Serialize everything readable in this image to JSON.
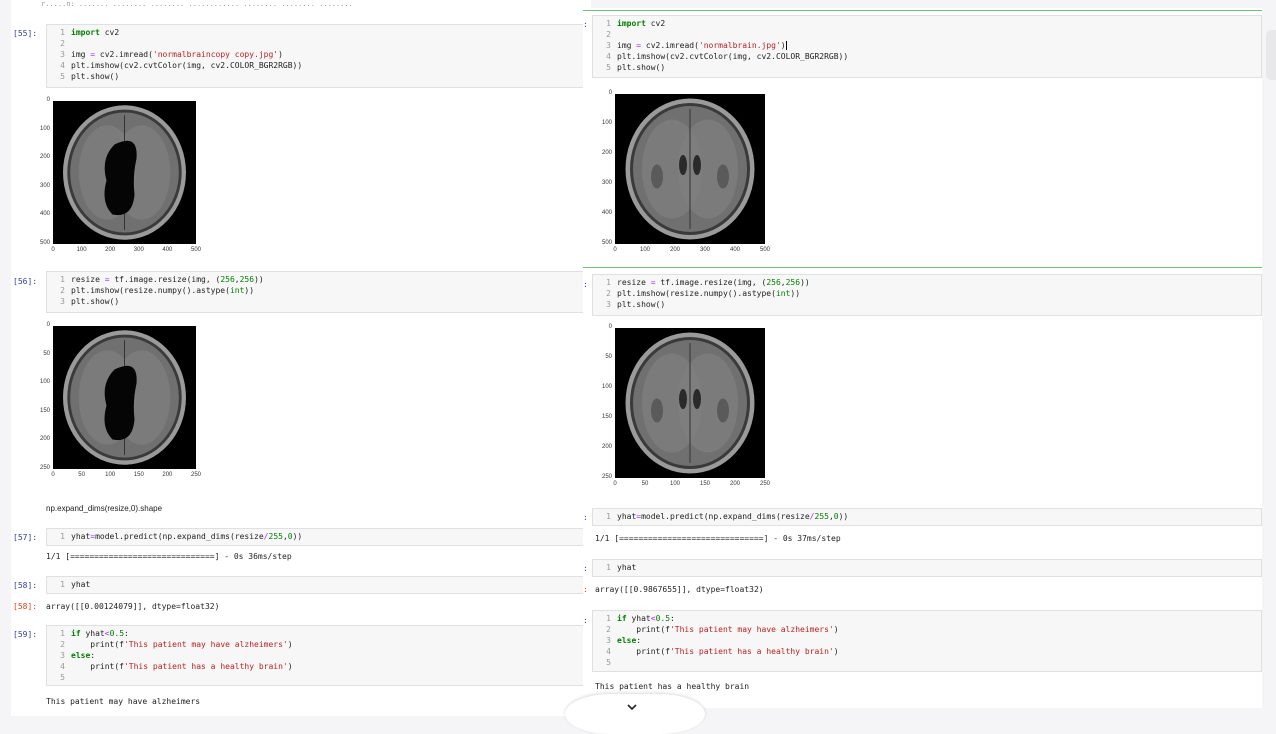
{
  "left": {
    "top_blurred": "r.....n: ....... ........ ........ ............ ........ ........ ........",
    "cells": [
      {
        "prompt": "[55]:",
        "lines": [
          "import cv2",
          "",
          "img = cv2.imread('normalbraincopy copy.jpg')",
          "plt.imshow(cv2.cvtColor(img, cv2.COLOR_BGR2RGB))",
          "plt.show()"
        ]
      },
      {
        "prompt": "[56]:",
        "lines": [
          "resize = tf.image.resize(img, (256,256))",
          "plt.imshow(resize.numpy().astype(int))",
          "plt.show()"
        ]
      },
      {
        "prompt": "[57]:",
        "lines": [
          "yhat=model.predict(np.expand_dims(resize/255,0))"
        ]
      },
      {
        "prompt": "[58]:",
        "lines": [
          "yhat"
        ]
      },
      {
        "prompt": "[59]:",
        "lines": [
          "if yhat<0.5:",
          "    print(f'This patient may have alzheimers')",
          "else:",
          "    print(f'This patient has a healthy brain')",
          ""
        ]
      }
    ],
    "plot1": {
      "yticks": [
        "0",
        "100",
        "200",
        "300",
        "400",
        "500"
      ],
      "xticks": [
        "0",
        "100",
        "200",
        "300",
        "400",
        "500"
      ]
    },
    "plot2": {
      "yticks": [
        "0",
        "50",
        "100",
        "150",
        "200",
        "250"
      ],
      "xticks": [
        "0",
        "50",
        "100",
        "150",
        "200",
        "250"
      ]
    },
    "markdown": "np.expand_dims(resize,0).shape",
    "predict_output": "1/1 [==============================] - 0s 36ms/step",
    "out_prompt_58": "[58]:",
    "yhat_output": "array([[0.00124079]], dtype=float32)",
    "print_output": "This patient may have alzheimers"
  },
  "right": {
    "cells": [
      {
        "prompt": ":",
        "lines": [
          "import cv2",
          "",
          "img = cv2.imread('normalbrain.jpg')",
          "plt.imshow(cv2.cvtColor(img, cv2.COLOR_BGR2RGB))",
          "plt.show()"
        ]
      },
      {
        "prompt": ":",
        "lines": [
          "resize = tf.image.resize(img, (256,256))",
          "plt.imshow(resize.numpy().astype(int))",
          "plt.show()"
        ]
      },
      {
        "prompt": ":",
        "lines": [
          "yhat=model.predict(np.expand_dims(resize/255,0))"
        ]
      },
      {
        "prompt": ":",
        "lines": [
          "yhat"
        ]
      },
      {
        "prompt": ":",
        "lines": [
          "if yhat<0.5:",
          "    print(f'This patient may have alzheimers')",
          "else:",
          "    print(f'This patient has a healthy brain')",
          ""
        ]
      }
    ],
    "plot1": {
      "yticks": [
        "0",
        "100",
        "200",
        "300",
        "400",
        "500"
      ],
      "xticks": [
        "0",
        "100",
        "200",
        "300",
        "400",
        "500"
      ]
    },
    "plot2": {
      "yticks": [
        "0",
        "50",
        "100",
        "150",
        "200",
        "250"
      ],
      "xticks": [
        "0",
        "50",
        "100",
        "150",
        "200",
        "250"
      ]
    },
    "predict_output": "1/1 [==============================] - 0s 37ms/step",
    "out_prompt": ":",
    "yhat_output": "array([[0.9867655]], dtype=float32)",
    "print_output": "This patient has a healthy brain"
  },
  "icons": {
    "scroll_down": "chevron-down-icon"
  }
}
